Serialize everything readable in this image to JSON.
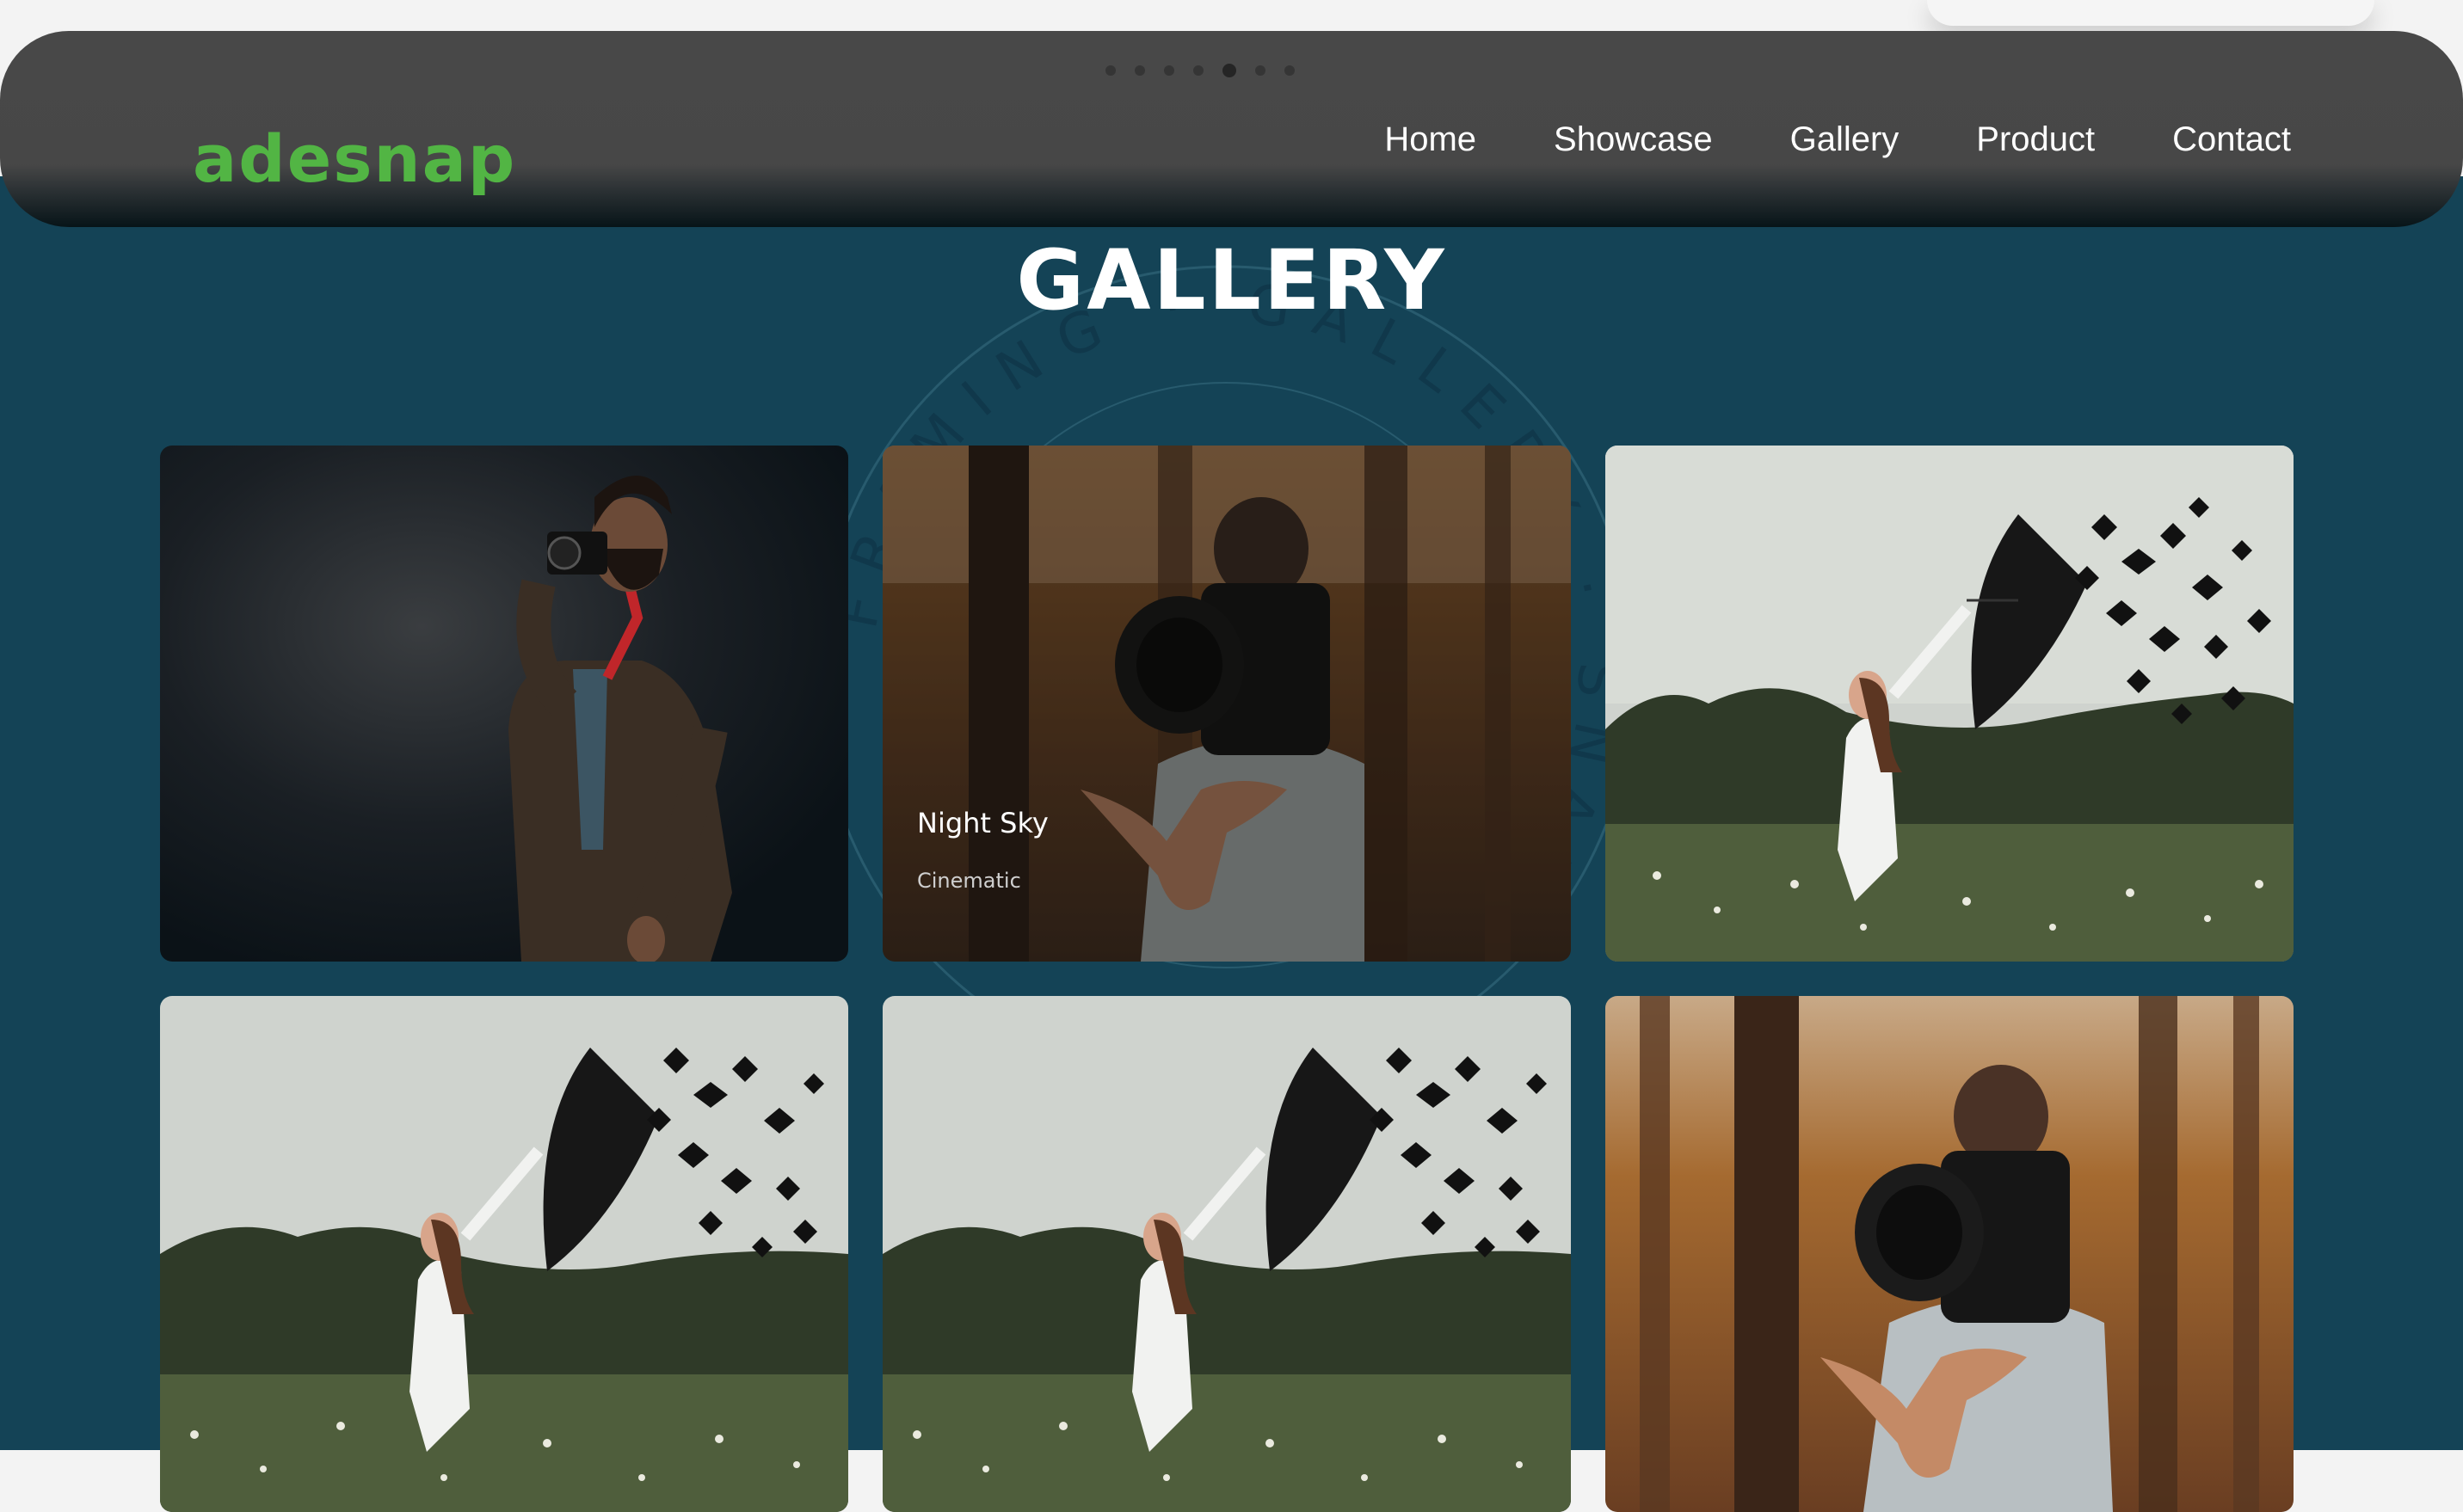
{
  "header": {
    "logo_text": "adesnap",
    "nav": [
      "Home",
      "Showcase",
      "Gallery",
      "Product",
      "Contact"
    ]
  },
  "gallery": {
    "title": "GALLERY",
    "stamp_text": "FRAMING · GALLERY · SNAP · ",
    "items": [
      {
        "scene": "photographer-dark",
        "caption": "",
        "category": ""
      },
      {
        "scene": "forest-camera",
        "caption": "Night Sky",
        "category": "Cinematic",
        "hovered": true
      },
      {
        "scene": "umbrella-girl",
        "caption": "",
        "category": ""
      },
      {
        "scene": "umbrella-girl",
        "caption": "",
        "category": ""
      },
      {
        "scene": "umbrella-girl",
        "caption": "",
        "category": ""
      },
      {
        "scene": "forest-camera",
        "caption": "",
        "category": ""
      }
    ]
  },
  "colors": {
    "page_bg": "#144356",
    "header_bg": "#474747",
    "logo_green": "#52b544",
    "text": "#ffffff"
  }
}
